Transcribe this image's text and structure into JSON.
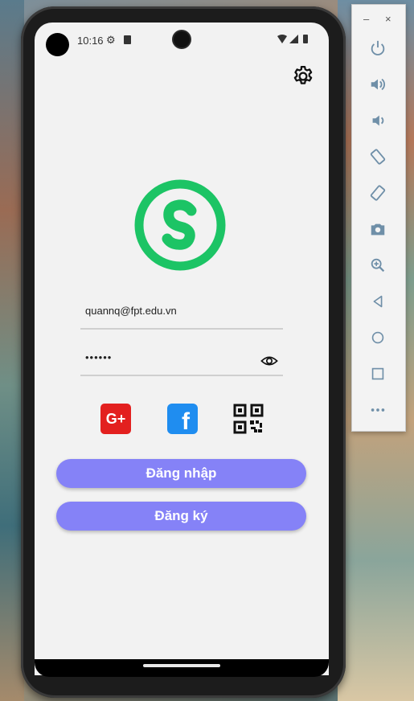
{
  "status_bar": {
    "time": "10:16"
  },
  "login": {
    "email_value": "quannq@fpt.edu.vn",
    "password_value": "••••••",
    "login_label": "Đăng nhập",
    "register_label": "Đăng ký"
  },
  "social": {
    "google_label": "G+",
    "facebook_label": "f"
  },
  "emulator": {
    "minimize_label": "–",
    "close_label": "×"
  },
  "icons": [
    "settings-icon",
    "logo-icon",
    "eye-icon",
    "google-plus-icon",
    "facebook-icon",
    "qr-code-icon",
    "power-icon",
    "volume-up-icon",
    "volume-down-icon",
    "rotate-left-icon",
    "rotate-right-icon",
    "camera-icon",
    "zoom-icon",
    "back-icon",
    "home-icon",
    "overview-icon",
    "more-icon"
  ],
  "colors": {
    "accent": "#8582f7",
    "logo_green": "#1cc465",
    "google_red": "#e3201f",
    "facebook_blue": "#1f8df0"
  }
}
